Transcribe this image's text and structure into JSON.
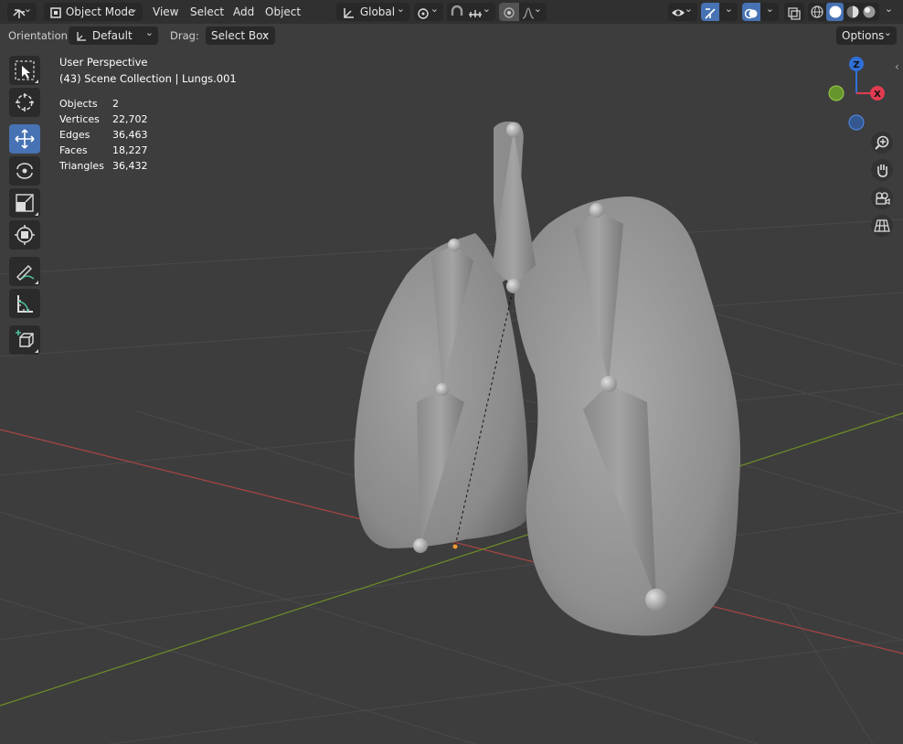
{
  "header": {
    "editor_type_icon": "editor-type-3d-viewport-icon",
    "mode": "Object Mode",
    "menus": [
      "View",
      "Select",
      "Add",
      "Object"
    ],
    "transform_orientation": "Global",
    "pivot_icon": "pivot-point-icon",
    "snap_icon": "snap-magnet-icon",
    "snap_target_icon": "snap-increment-icon",
    "proportional_icon": "proportional-editing-icon",
    "falloff_icon": "falloff-curve-icon",
    "visibility_icon": "eye-visibility-icon",
    "gizmo_icon": "gizmo-icon",
    "overlay_icon": "overlay-icon",
    "xray_icon": "xray-icon",
    "shading_modes": [
      "wireframe",
      "solid",
      "material-preview",
      "rendered"
    ]
  },
  "tool_settings": {
    "orientation_label": "Orientation:",
    "orientation_value": "Default",
    "drag_label": "Drag:",
    "drag_value": "Select Box",
    "options": "Options"
  },
  "toolbar": {
    "tools": [
      "select-box",
      "cursor",
      "move",
      "rotate",
      "scale",
      "transform",
      "annotate",
      "measure",
      "add-cube"
    ],
    "active_tool": "move"
  },
  "overlay": {
    "perspective": "User Perspective",
    "collection": "(43) Scene Collection | Lungs.001",
    "stats": [
      {
        "label": "Objects",
        "value": "2"
      },
      {
        "label": "Vertices",
        "value": "22,702"
      },
      {
        "label": "Edges",
        "value": "36,463"
      },
      {
        "label": "Faces",
        "value": "18,227"
      },
      {
        "label": "Triangles",
        "value": "36,432"
      }
    ]
  },
  "nav_gizmo": {
    "axes": [
      {
        "label": "Z",
        "color": "#2f6fd6"
      },
      {
        "label": "X",
        "color": "#e23c51"
      },
      {
        "label": "Y",
        "color": "#6ea52a"
      }
    ],
    "buttons": [
      "zoom",
      "pan",
      "camera",
      "ortho"
    ]
  },
  "colors": {
    "accent": "#4772b3",
    "viewport_bg": "#3d3d3d",
    "header_bg": "#303030",
    "x_axis": "#c24a4a",
    "y_axis": "#6d8f26"
  }
}
